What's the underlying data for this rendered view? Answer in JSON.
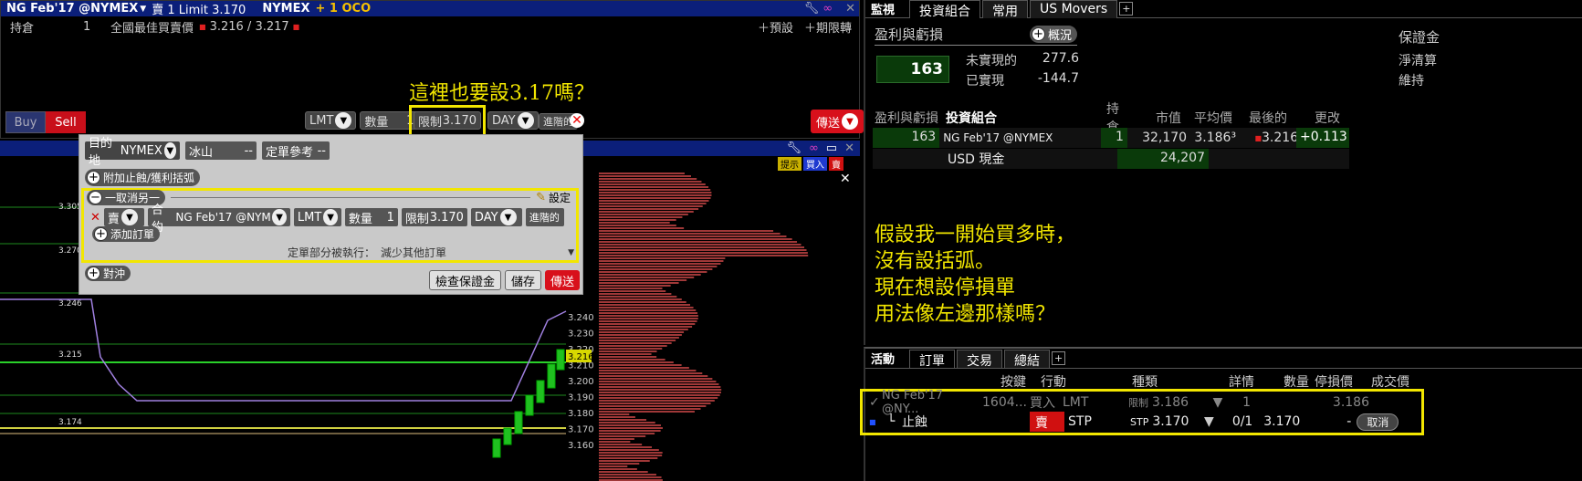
{
  "order_panel": {
    "title_contract": "NG Feb'17 @NYMEX",
    "title_order": "賣 1 Limit 3.170",
    "title_exchange": "NYMEX",
    "title_oco": "+ 1 OCO",
    "position_label": "持倉",
    "position_value": "1",
    "best_bid_label": "全國最佳買賣價",
    "best_bid_value": "3.216 / 3.217",
    "preset_label": "預設",
    "period_label": "期限轉",
    "buy_label": "Buy",
    "sell_label": "Sell",
    "order_type": "LMT",
    "qty_label": "數量",
    "qty_value": "1",
    "limit_label": "限制",
    "limit_value": "3.170",
    "tif": "DAY",
    "adv_label": "進階的",
    "send_label": "傳送"
  },
  "annotations": {
    "top_question": "這裡也要設3.17嗎？",
    "right_note": [
      "假設我一開始買多時，",
      "沒有設括弧。",
      "現在想設停損單",
      "用法像左邊那樣嗎？"
    ]
  },
  "dialog": {
    "dest_label": "目的地",
    "dest_value": "NYMEX",
    "iceberg_label": "冰山",
    "iceberg_value": "--",
    "ref_label": "定單參考",
    "ref_value": "--",
    "attach_label": "附加止蝕/獲利括弧",
    "oco_label": "一取消另一",
    "settings_label": "設定",
    "row_action": "賣",
    "row_contract_label": "合約",
    "row_contract": "NG Feb'17 @NYMEX",
    "row_type": "LMT",
    "row_qty_label": "數量",
    "row_qty": "1",
    "row_limit_label": "限制",
    "row_limit": "3.170",
    "row_tif": "DAY",
    "row_adv": "進階的",
    "add_order_label": "添加訂單",
    "partial_label": "定單部分被執行：",
    "partial_value": "減少其他訂單",
    "hedge_label": "對沖",
    "check_margin": "檢查保證金",
    "save_label": "儲存",
    "send_label": "傳送"
  },
  "chart": {
    "buttons": [
      "提示",
      "買入",
      "賣"
    ],
    "price_labels": [
      "3.305",
      "3.270",
      "3.246",
      "3.215",
      "3.174"
    ],
    "axis_ticks": [
      "3.240",
      "3.230",
      "3.220",
      "3.210",
      "3.200",
      "3.190",
      "3.180",
      "3.170",
      "3.160"
    ],
    "current_price": "3.216"
  },
  "monitor": {
    "tabs": [
      "監視",
      "投資組合",
      "常用",
      "US Movers"
    ],
    "pnl_title": "盈利與虧損",
    "overview_label": "概況",
    "pnl_value": "163",
    "unrealized_label": "未實現的",
    "unrealized_value": "277.6",
    "realized_label": "已實現",
    "realized_value": "-144.7",
    "margin_title": "保證金",
    "net_liq_label": "淨清算",
    "maint_label": "維持",
    "table_headers": [
      "盈利與虧損",
      "投資組合",
      "持倉",
      "市值",
      "平均價",
      "最後的",
      "更改"
    ],
    "rows": [
      {
        "pnl": "163",
        "name": "NG Feb'17 @NYMEX",
        "pos": "1",
        "mkt": "32,170",
        "avg": "3.186³",
        "last": "3.216",
        "chg": "+0.113"
      },
      {
        "pnl": "",
        "name": "USD 現金",
        "pos": "",
        "mkt": "24,207",
        "avg": "",
        "last": "",
        "chg": ""
      }
    ]
  },
  "activity": {
    "tabs": [
      "活動",
      "訂單",
      "交易",
      "總結"
    ],
    "headers": [
      "按鍵",
      "行動",
      "種類",
      "詳情",
      "數量",
      "停損價",
      "成交價"
    ],
    "row1": {
      "contract": "NG Feb'17 @NY...",
      "key": "1604...",
      "action": "買入",
      "type": "LMT",
      "detail_label": "限制",
      "detail": "3.186",
      "qty": "1",
      "stop": "",
      "fill": "3.186"
    },
    "row2": {
      "contract": "止蝕",
      "action": "賣",
      "type": "STP",
      "detail_label": "STP",
      "detail": "3.170",
      "qty": "0/1",
      "stop": "3.170",
      "fill": "-",
      "cancel": "取消"
    }
  }
}
